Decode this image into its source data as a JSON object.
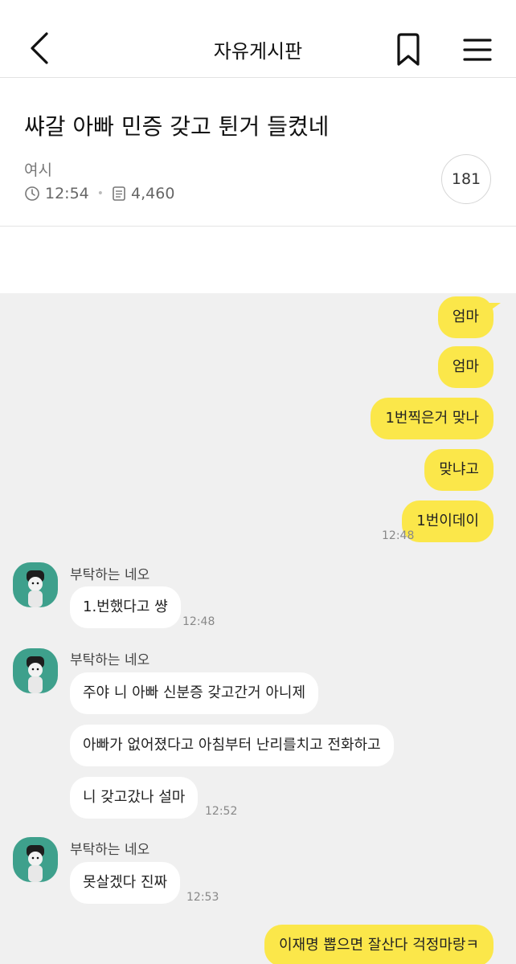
{
  "header": {
    "title": "자유게시판",
    "back_icon": "chevron-left-icon",
    "bookmark_icon": "bookmark-icon",
    "menu_icon": "hamburger-menu-icon"
  },
  "post": {
    "title": "쌰갈 아빠 민증 갖고 튄거 들켰네",
    "author": "여시",
    "time": "12:54",
    "views": "4,460",
    "comments": "181"
  },
  "chat": {
    "accent": "#fbe74a",
    "me": [
      {
        "text": "엄마"
      },
      {
        "text": "엄마"
      },
      {
        "text": "1번찍은거 맞나"
      },
      {
        "text": "맞냐고"
      },
      {
        "text": "1번이데이",
        "time": "12:48"
      },
      {
        "text": "이재명 뽑으면 잘산다 걱정마랑ㅋ"
      }
    ],
    "groups": [
      {
        "sender": "부탁하는 네오",
        "messages": [
          "1.번했다고 썅"
        ],
        "time": "12:48"
      },
      {
        "sender": "부탁하는 네오",
        "messages": [
          "주야 니 아빠 신분증 갖고간거 아니제",
          "아빠가 없어졌다고 아침부터 난리를치고 전화하고",
          "니 갖고갔나 설마"
        ],
        "time": "12:52"
      },
      {
        "sender": "부탁하는 네오",
        "messages": [
          "못살겠다 진짜"
        ],
        "time": "12:53"
      }
    ]
  }
}
